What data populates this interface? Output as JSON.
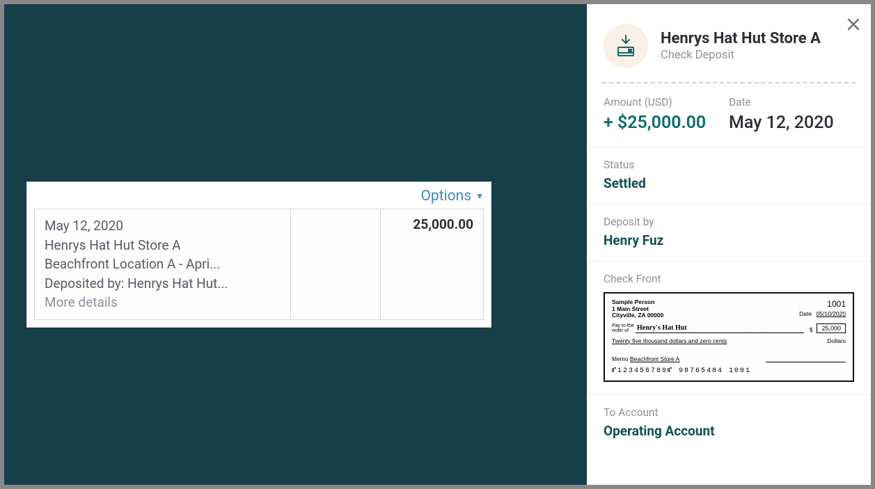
{
  "card": {
    "options_label": "Options",
    "date": "May 12, 2020",
    "merchant": "Henrys Hat Hut Store A",
    "location": "Beachfront Location A - Apri...",
    "deposited_by": "Deposited by: Henrys Hat Hut...",
    "more": "More details",
    "amount": "25,000.00"
  },
  "panel": {
    "title": "Henrys Hat Hut Store A",
    "subtitle": "Check Deposit",
    "amount_label": "Amount (USD)",
    "amount": "+ $25,000.00",
    "date_label": "Date",
    "date": "May 12, 2020",
    "status_label": "Status",
    "status_value": "Settled",
    "deposit_by_label": "Deposit by",
    "deposit_by_value": "Henry Fuz",
    "check_front_label": "Check Front",
    "to_account_label": "To Account",
    "to_account_value": "Operating Account"
  },
  "check": {
    "from_name": "Sample Person",
    "from_addr1": "1 Main Street",
    "from_addr2": "Cityville, ZA  00000",
    "check_no": "1001",
    "date_label": "Date",
    "date": "05/10/2020",
    "payto_label": "Pay to the\norder of",
    "payto": "Henry's Hat Hut",
    "dollar_sign": "$",
    "amount_box": "25,000",
    "words": "Twenty five thousand dollars and zero cents",
    "dollars_label": "Dollars",
    "memo_label": "Memo",
    "memo": "Beachfront Store A",
    "micr": "⑈123456789⑈ 98765484  1001"
  }
}
